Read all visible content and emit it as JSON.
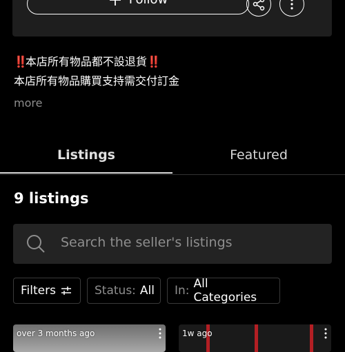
{
  "profile": {
    "follow_label": "Follow"
  },
  "bio": {
    "line1_mark": "‼️",
    "line1_text": "本店所有物品都不設退貨",
    "line1_mark_end": "‼️",
    "line2_text": "本店所有物品購買支持需交付訂金￼",
    "more_label": "more"
  },
  "tabs": [
    {
      "label": "Listings",
      "active": true
    },
    {
      "label": "Featured",
      "active": false
    }
  ],
  "listings": {
    "count_label": "9 listings",
    "search_placeholder": "Search the seller's listings"
  },
  "filters": {
    "filters_label": "Filters",
    "status_prefix": "Status:",
    "status_value": "All",
    "category_prefix": "In:",
    "category_value": "All Categories"
  },
  "items": [
    {
      "time": "over 3 months ago"
    },
    {
      "time": "1w ago"
    }
  ],
  "colors": {
    "background": "#000000",
    "card": "#1e1e1e",
    "muted_text": "#8e8e8e",
    "alert_red": "#e3262e"
  }
}
